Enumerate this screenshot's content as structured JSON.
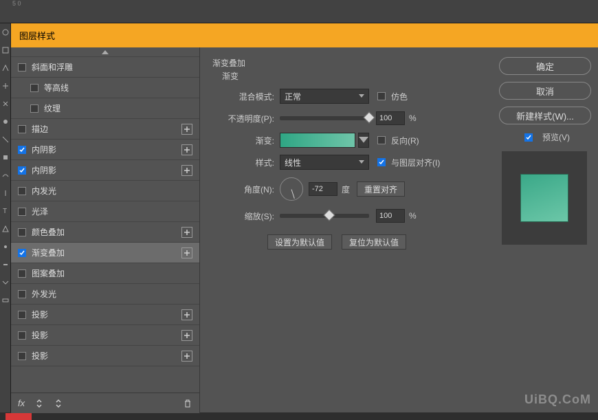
{
  "dialog": {
    "title": "图层样式"
  },
  "sidebar": {
    "items": [
      {
        "label": "斜面和浮雕",
        "checked": false,
        "add": false,
        "indent": false
      },
      {
        "label": "等高线",
        "checked": false,
        "add": false,
        "indent": true
      },
      {
        "label": "纹理",
        "checked": false,
        "add": false,
        "indent": true
      },
      {
        "label": "描边",
        "checked": false,
        "add": true,
        "indent": false
      },
      {
        "label": "内阴影",
        "checked": true,
        "add": true,
        "indent": false
      },
      {
        "label": "内阴影",
        "checked": true,
        "add": true,
        "indent": false
      },
      {
        "label": "内发光",
        "checked": false,
        "add": false,
        "indent": false
      },
      {
        "label": "光泽",
        "checked": false,
        "add": false,
        "indent": false
      },
      {
        "label": "颜色叠加",
        "checked": false,
        "add": true,
        "indent": false
      },
      {
        "label": "渐变叠加",
        "checked": true,
        "add": true,
        "indent": false,
        "selected": true
      },
      {
        "label": "图案叠加",
        "checked": false,
        "add": false,
        "indent": false
      },
      {
        "label": "外发光",
        "checked": false,
        "add": false,
        "indent": false
      },
      {
        "label": "投影",
        "checked": false,
        "add": true,
        "indent": false
      },
      {
        "label": "投影",
        "checked": false,
        "add": true,
        "indent": false
      },
      {
        "label": "投影",
        "checked": false,
        "add": true,
        "indent": false
      }
    ],
    "fx_label": "fx"
  },
  "panel": {
    "section_title": "渐变叠加",
    "sub_title": "渐变",
    "blend_mode_label": "混合模式:",
    "blend_mode_value": "正常",
    "dither_label": "仿色",
    "opacity_label": "不透明度(P):",
    "opacity_value": "100",
    "opacity_unit": "%",
    "gradient_label": "渐变:",
    "reverse_label": "反向(R)",
    "style_label": "样式:",
    "style_value": "线性",
    "align_label": "与图层对齐(I)",
    "angle_label": "角度(N):",
    "angle_value": "-72",
    "angle_unit": "度",
    "reset_align": "重置对齐",
    "scale_label": "缩放(S):",
    "scale_value": "100",
    "scale_unit": "%",
    "make_default": "设置为默认值",
    "reset_default": "复位为默认值"
  },
  "right": {
    "ok": "确定",
    "cancel": "取消",
    "new_style": "新建样式(W)...",
    "preview": "预览(V)"
  },
  "watermark": "UiBQ.CoM",
  "ruler_mark": "5\n0"
}
